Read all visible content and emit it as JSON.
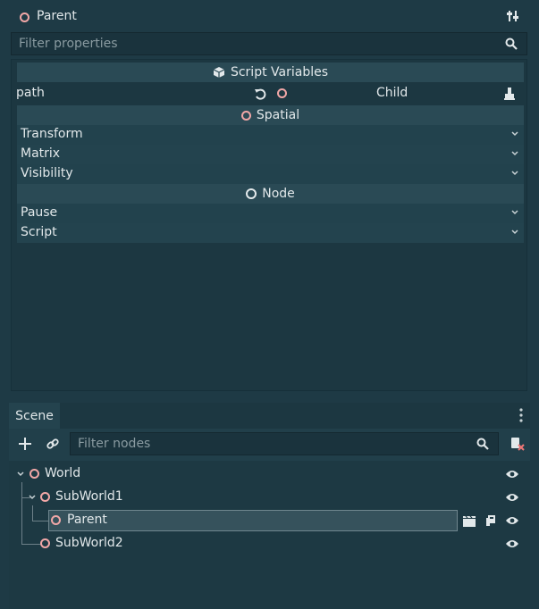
{
  "inspector": {
    "title": "Parent",
    "filter_placeholder": "Filter properties",
    "sections": {
      "script_variables": "Script Variables",
      "spatial": "Spatial",
      "node": "Node"
    },
    "path_row": {
      "label": "path",
      "value": "Child"
    },
    "spatial_props": [
      "Transform",
      "Matrix",
      "Visibility"
    ],
    "node_props": [
      "Pause",
      "Script"
    ]
  },
  "scene": {
    "tab_label": "Scene",
    "filter_placeholder": "Filter nodes",
    "tree": [
      {
        "name": "World"
      },
      {
        "name": "SubWorld1"
      },
      {
        "name": "Parent"
      },
      {
        "name": "SubWorld2"
      }
    ]
  },
  "colors": {
    "background": "#1e3a45",
    "node_icon": "#f1a7a7",
    "selection": "#36525c"
  }
}
